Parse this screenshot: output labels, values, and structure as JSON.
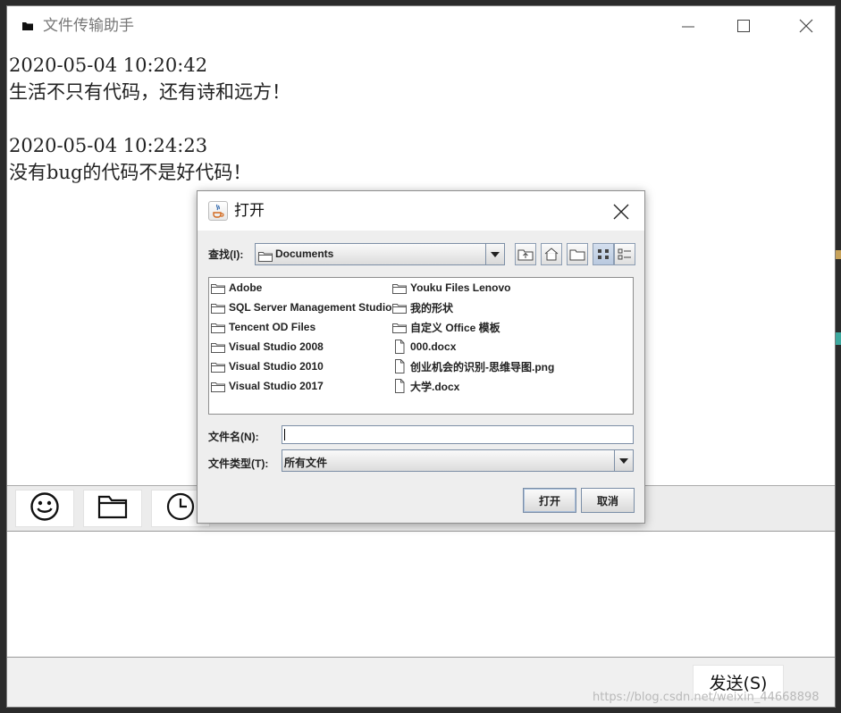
{
  "window": {
    "title": "文件传输助手"
  },
  "messages": [
    {
      "time": "2020-05-04 10:20:42",
      "text": "生活不只有代码，还有诗和远方！"
    },
    {
      "time": "2020-05-04 10:24:23",
      "text": "没有bug的代码不是好代码！"
    }
  ],
  "toolbar": {
    "icons": [
      "smile-icon",
      "folder-icon",
      "clock-icon"
    ]
  },
  "send_button": "发送(S)",
  "watermark": "https://blog.csdn.net/weixin_44668898",
  "dialog": {
    "title": "打开",
    "look_in_label": "查找(I):",
    "look_in_value": "Documents",
    "files": [
      {
        "name": "Adobe",
        "kind": "folder"
      },
      {
        "name": "SQL Server Management Studio",
        "kind": "folder"
      },
      {
        "name": "Tencent OD Files",
        "kind": "folder"
      },
      {
        "name": "Visual Studio 2008",
        "kind": "folder"
      },
      {
        "name": "Visual Studio 2010",
        "kind": "folder"
      },
      {
        "name": "Visual Studio 2017",
        "kind": "folder"
      },
      {
        "name": "Youku Files Lenovo",
        "kind": "folder"
      },
      {
        "name": "我的形状",
        "kind": "folder"
      },
      {
        "name": "自定义 Office 模板",
        "kind": "folder"
      },
      {
        "name": "000.docx",
        "kind": "file"
      },
      {
        "name": "创业机会的识别-思维导图.png",
        "kind": "file"
      },
      {
        "name": "大学.docx",
        "kind": "file"
      }
    ],
    "file_name_label": "文件名(N):",
    "file_name_value": "",
    "file_type_label": "文件类型(T):",
    "file_type_value": "所有文件",
    "open_button": "打开",
    "cancel_button": "取消"
  }
}
